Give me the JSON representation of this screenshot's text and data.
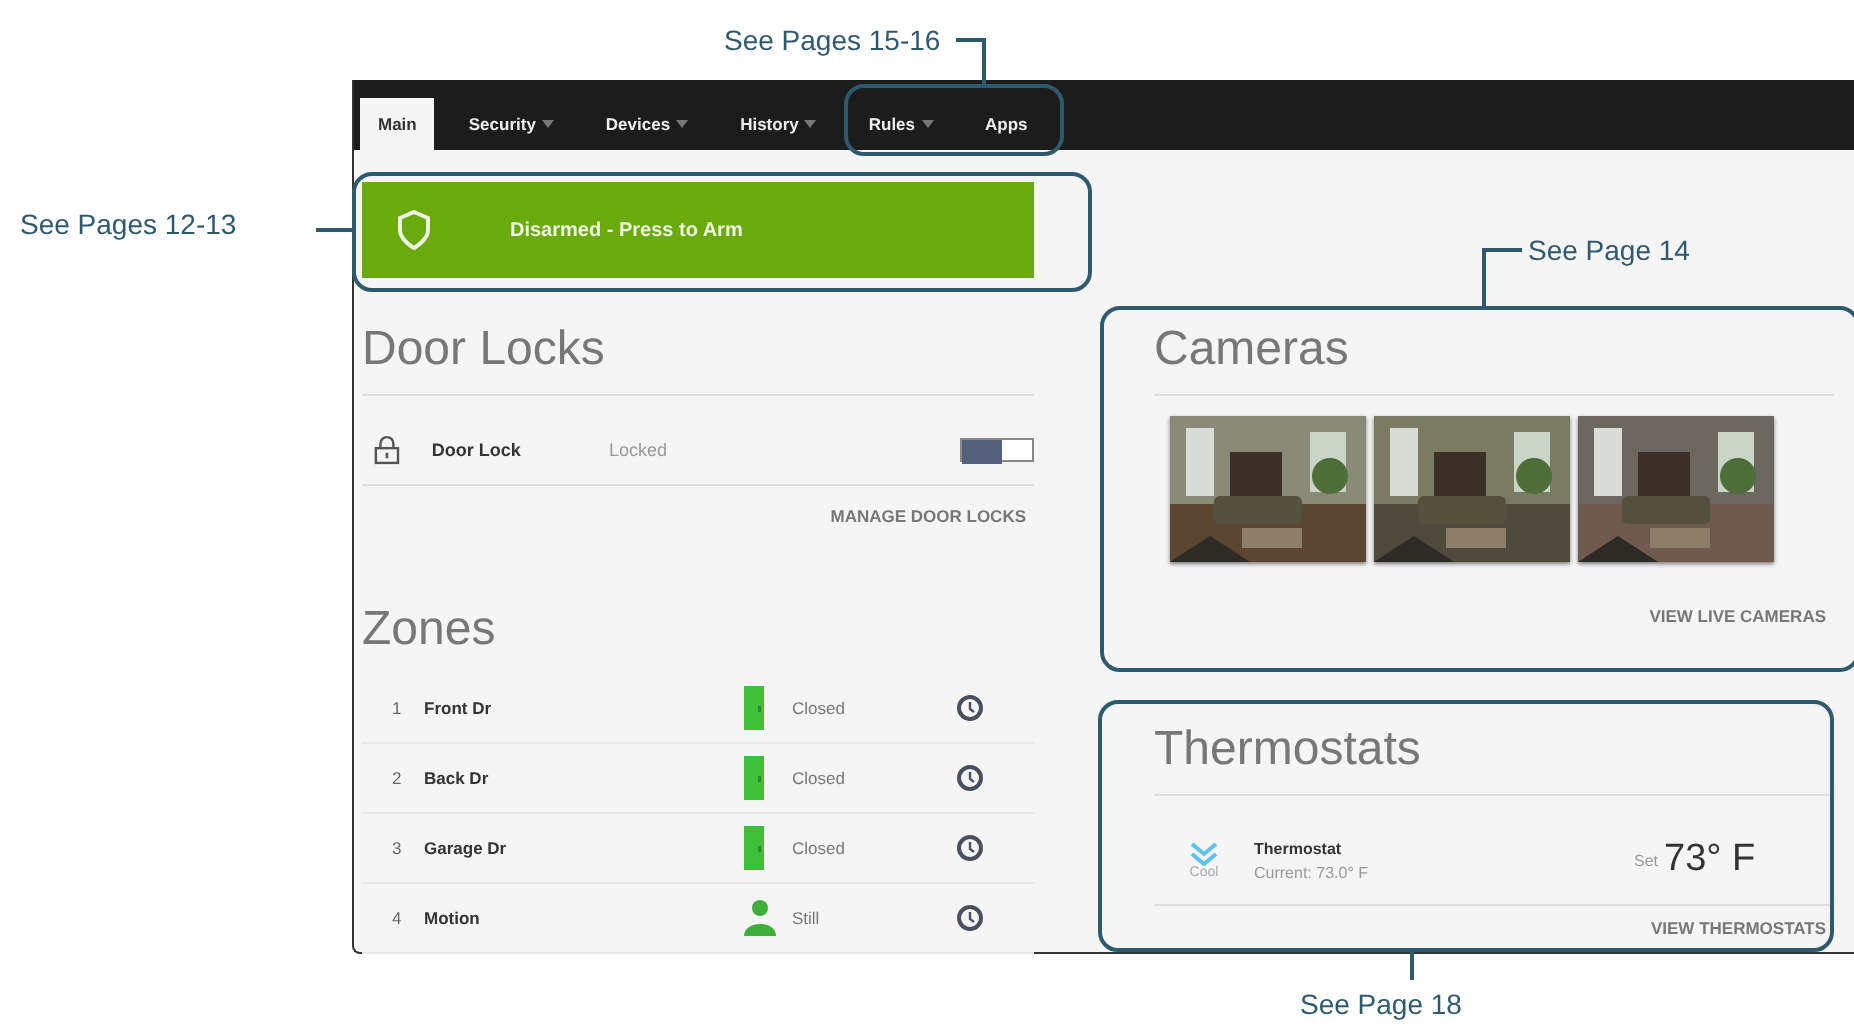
{
  "callouts": [
    {
      "text": "See Pages 15-16"
    },
    {
      "text": "See Pages 12-13"
    },
    {
      "text": "See Page 14"
    },
    {
      "text": "See Page 18"
    }
  ],
  "tabs": [
    {
      "label": "Main",
      "selected": true,
      "menu": false
    },
    {
      "label": "Security",
      "selected": false,
      "menu": true
    },
    {
      "label": "Devices",
      "selected": false,
      "menu": true
    },
    {
      "label": "History",
      "selected": false,
      "menu": true
    },
    {
      "label": "Rules",
      "selected": false,
      "menu": true
    },
    {
      "label": "Apps",
      "selected": false,
      "menu": false
    }
  ],
  "arm_bar": {
    "label": "Disarmed - Press to Arm"
  },
  "door_locks": {
    "title": "Door Locks",
    "items": [
      {
        "name": "Door Lock",
        "status": "Locked",
        "locked": true
      }
    ],
    "link": "MANAGE DOOR LOCKS"
  },
  "zones": {
    "title": "Zones",
    "items": [
      {
        "number": "1",
        "name": "Front Dr",
        "kind": "door",
        "status": "Closed"
      },
      {
        "number": "2",
        "name": "Back Dr",
        "kind": "door",
        "status": "Closed"
      },
      {
        "number": "3",
        "name": "Garage Dr",
        "kind": "door",
        "status": "Closed"
      },
      {
        "number": "4",
        "name": "Motion",
        "kind": "motion",
        "status": "Still"
      }
    ]
  },
  "cameras": {
    "title": "Cameras",
    "link": "VIEW LIVE CAMERAS"
  },
  "thermostats": {
    "title": "Thermostats",
    "items": [
      {
        "mode": "Cool",
        "name": "Thermostat",
        "current": "Current: 73.0° F",
        "set_label": "Set",
        "set_value": "73° F"
      }
    ],
    "link": "VIEW THERMOSTATS"
  }
}
